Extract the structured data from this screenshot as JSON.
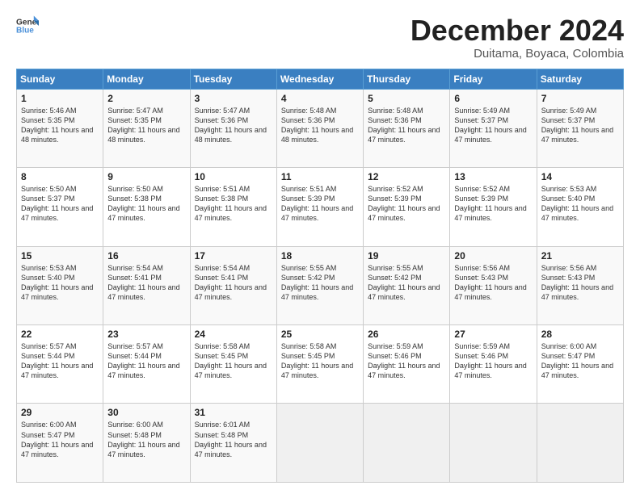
{
  "logo": {
    "general": "General",
    "blue": "Blue"
  },
  "title": "December 2024",
  "location": "Duitama, Boyaca, Colombia",
  "days_of_week": [
    "Sunday",
    "Monday",
    "Tuesday",
    "Wednesday",
    "Thursday",
    "Friday",
    "Saturday"
  ],
  "weeks": [
    [
      {
        "day": "1",
        "sunrise": "5:46 AM",
        "sunset": "5:35 PM",
        "daylight": "11 hours and 48 minutes."
      },
      {
        "day": "2",
        "sunrise": "5:47 AM",
        "sunset": "5:35 PM",
        "daylight": "11 hours and 48 minutes."
      },
      {
        "day": "3",
        "sunrise": "5:47 AM",
        "sunset": "5:36 PM",
        "daylight": "11 hours and 48 minutes."
      },
      {
        "day": "4",
        "sunrise": "5:48 AM",
        "sunset": "5:36 PM",
        "daylight": "11 hours and 48 minutes."
      },
      {
        "day": "5",
        "sunrise": "5:48 AM",
        "sunset": "5:36 PM",
        "daylight": "11 hours and 47 minutes."
      },
      {
        "day": "6",
        "sunrise": "5:49 AM",
        "sunset": "5:37 PM",
        "daylight": "11 hours and 47 minutes."
      },
      {
        "day": "7",
        "sunrise": "5:49 AM",
        "sunset": "5:37 PM",
        "daylight": "11 hours and 47 minutes."
      }
    ],
    [
      {
        "day": "8",
        "sunrise": "5:50 AM",
        "sunset": "5:37 PM",
        "daylight": "11 hours and 47 minutes."
      },
      {
        "day": "9",
        "sunrise": "5:50 AM",
        "sunset": "5:38 PM",
        "daylight": "11 hours and 47 minutes."
      },
      {
        "day": "10",
        "sunrise": "5:51 AM",
        "sunset": "5:38 PM",
        "daylight": "11 hours and 47 minutes."
      },
      {
        "day": "11",
        "sunrise": "5:51 AM",
        "sunset": "5:39 PM",
        "daylight": "11 hours and 47 minutes."
      },
      {
        "day": "12",
        "sunrise": "5:52 AM",
        "sunset": "5:39 PM",
        "daylight": "11 hours and 47 minutes."
      },
      {
        "day": "13",
        "sunrise": "5:52 AM",
        "sunset": "5:39 PM",
        "daylight": "11 hours and 47 minutes."
      },
      {
        "day": "14",
        "sunrise": "5:53 AM",
        "sunset": "5:40 PM",
        "daylight": "11 hours and 47 minutes."
      }
    ],
    [
      {
        "day": "15",
        "sunrise": "5:53 AM",
        "sunset": "5:40 PM",
        "daylight": "11 hours and 47 minutes."
      },
      {
        "day": "16",
        "sunrise": "5:54 AM",
        "sunset": "5:41 PM",
        "daylight": "11 hours and 47 minutes."
      },
      {
        "day": "17",
        "sunrise": "5:54 AM",
        "sunset": "5:41 PM",
        "daylight": "11 hours and 47 minutes."
      },
      {
        "day": "18",
        "sunrise": "5:55 AM",
        "sunset": "5:42 PM",
        "daylight": "11 hours and 47 minutes."
      },
      {
        "day": "19",
        "sunrise": "5:55 AM",
        "sunset": "5:42 PM",
        "daylight": "11 hours and 47 minutes."
      },
      {
        "day": "20",
        "sunrise": "5:56 AM",
        "sunset": "5:43 PM",
        "daylight": "11 hours and 47 minutes."
      },
      {
        "day": "21",
        "sunrise": "5:56 AM",
        "sunset": "5:43 PM",
        "daylight": "11 hours and 47 minutes."
      }
    ],
    [
      {
        "day": "22",
        "sunrise": "5:57 AM",
        "sunset": "5:44 PM",
        "daylight": "11 hours and 47 minutes."
      },
      {
        "day": "23",
        "sunrise": "5:57 AM",
        "sunset": "5:44 PM",
        "daylight": "11 hours and 47 minutes."
      },
      {
        "day": "24",
        "sunrise": "5:58 AM",
        "sunset": "5:45 PM",
        "daylight": "11 hours and 47 minutes."
      },
      {
        "day": "25",
        "sunrise": "5:58 AM",
        "sunset": "5:45 PM",
        "daylight": "11 hours and 47 minutes."
      },
      {
        "day": "26",
        "sunrise": "5:59 AM",
        "sunset": "5:46 PM",
        "daylight": "11 hours and 47 minutes."
      },
      {
        "day": "27",
        "sunrise": "5:59 AM",
        "sunset": "5:46 PM",
        "daylight": "11 hours and 47 minutes."
      },
      {
        "day": "28",
        "sunrise": "6:00 AM",
        "sunset": "5:47 PM",
        "daylight": "11 hours and 47 minutes."
      }
    ],
    [
      {
        "day": "29",
        "sunrise": "6:00 AM",
        "sunset": "5:47 PM",
        "daylight": "11 hours and 47 minutes."
      },
      {
        "day": "30",
        "sunrise": "6:00 AM",
        "sunset": "5:48 PM",
        "daylight": "11 hours and 47 minutes."
      },
      {
        "day": "31",
        "sunrise": "6:01 AM",
        "sunset": "5:48 PM",
        "daylight": "11 hours and 47 minutes."
      },
      null,
      null,
      null,
      null
    ]
  ]
}
